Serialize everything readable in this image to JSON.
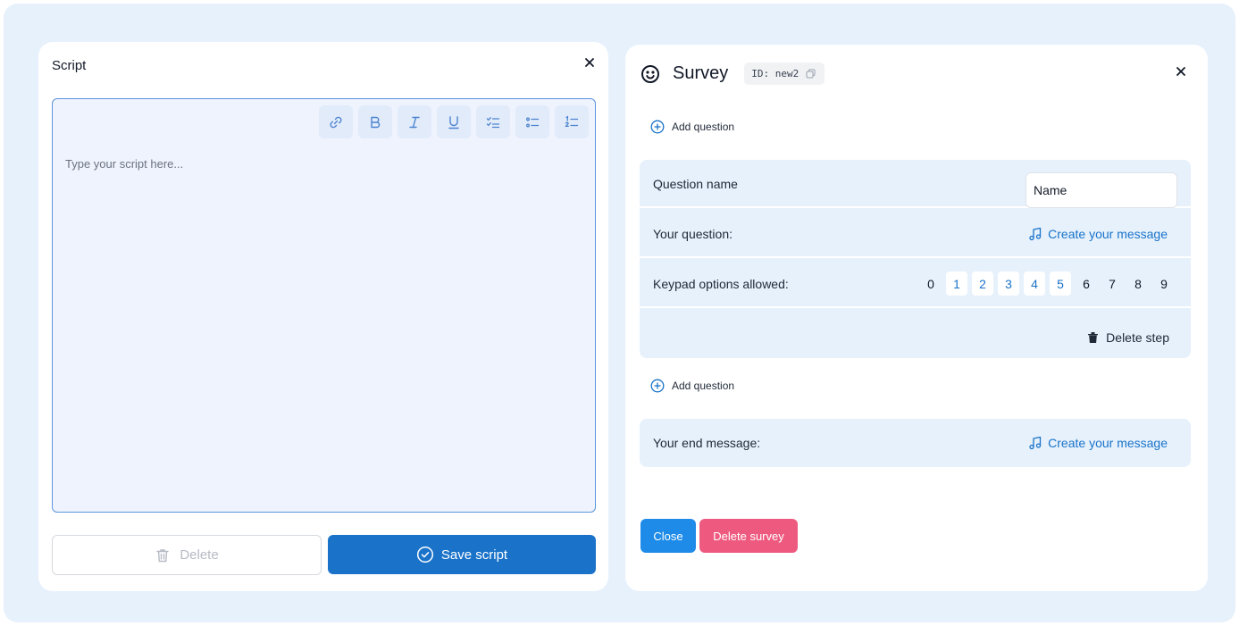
{
  "script_panel": {
    "title": "Script",
    "editor_placeholder": "Type your script here...",
    "toolbar": [
      {
        "icon": "link-icon"
      },
      {
        "icon": "bold-icon"
      },
      {
        "icon": "italic-icon"
      },
      {
        "icon": "underline-icon"
      },
      {
        "icon": "checklist-icon"
      },
      {
        "icon": "bullet-list-icon"
      },
      {
        "icon": "numbered-list-icon"
      }
    ],
    "delete_label": "Delete",
    "save_label": "Save script"
  },
  "survey_panel": {
    "title": "Survey",
    "id_text": "ID: new2",
    "add_question_label": "Add question",
    "question": {
      "name_label": "Question name",
      "name_value": "Name",
      "your_question_label": "Your question:",
      "create_message_label": "Create your message",
      "keypad_label": "Keypad options allowed:",
      "keypad_keys": [
        "0",
        "1",
        "2",
        "3",
        "4",
        "5",
        "6",
        "7",
        "8",
        "9"
      ],
      "keypad_selected": [
        "1",
        "2",
        "3",
        "4",
        "5"
      ],
      "delete_step_label": "Delete step"
    },
    "end_message_label": "Your end message:",
    "close_label": "Close",
    "delete_survey_label": "Delete survey"
  },
  "colors": {
    "primary": "#1a73c9",
    "close_button": "#1e8be8",
    "delete_button": "#ee5a7f",
    "panel_background": "#e6f1fc"
  }
}
